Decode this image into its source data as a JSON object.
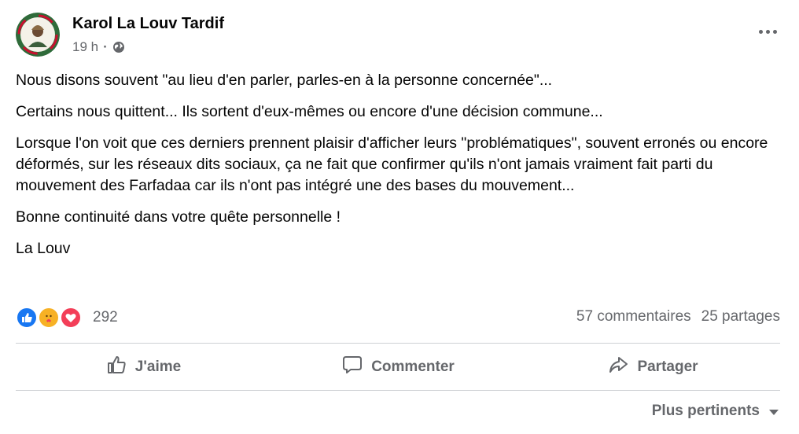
{
  "post": {
    "author": "Karol La Louv Tardif",
    "time": "19 h",
    "separator": "·",
    "paragraphs": [
      "Nous disons souvent \"au lieu d'en parler, parles-en à la personne concernée\"...",
      "Certains nous quittent... Ils sortent d'eux-mêmes ou encore d'une décision commune...",
      "Lorsque l'on voit que ces derniers prennent plaisir d'afficher leurs \"problématiques\", souvent erronés ou encore déformés, sur les réseaux dits sociaux, ça ne fait que confirmer qu'ils n'ont jamais vraiment fait parti du mouvement des Farfadaa car ils n'ont pas intégré une des bases du mouvement...",
      "Bonne continuité dans votre quête personnelle !",
      "La Louv"
    ]
  },
  "reactions": {
    "icons": [
      "like-icon",
      "care-icon",
      "love-icon"
    ],
    "count": "292",
    "colors": {
      "like": "#1877f2",
      "care": "#f7b125",
      "love": "#f33e58"
    }
  },
  "stats": {
    "comments": "57 commentaires",
    "shares": "25 partages"
  },
  "actions": {
    "like": "J'aime",
    "comment": "Commenter",
    "share": "Partager"
  },
  "sort": {
    "label": "Plus pertinents"
  },
  "colors": {
    "text": "#050505",
    "secondary": "#65676b",
    "divider": "#ced0d4"
  }
}
